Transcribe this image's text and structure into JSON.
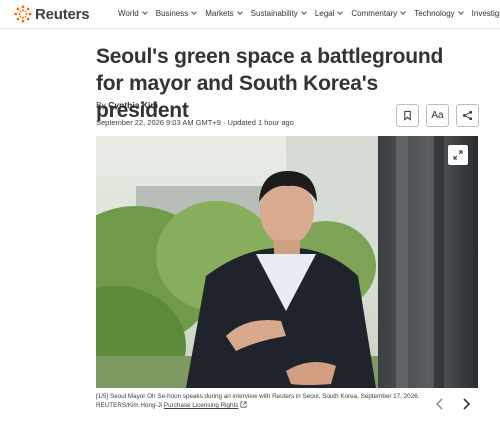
{
  "brand": {
    "name": "Reuters",
    "accent": "#fa6400"
  },
  "nav": {
    "items": [
      {
        "label": "World",
        "dropdown": true
      },
      {
        "label": "Business",
        "dropdown": true
      },
      {
        "label": "Markets",
        "dropdown": true
      },
      {
        "label": "Sustainability",
        "dropdown": true
      },
      {
        "label": "Legal",
        "dropdown": true
      },
      {
        "label": "Commentary",
        "dropdown": true
      },
      {
        "label": "Technology",
        "dropdown": true
      },
      {
        "label": "Investigations",
        "dropdown": false
      }
    ]
  },
  "article": {
    "headline": "Seoul's green space a battleground for mayor and South Korea's president",
    "byline_prefix": "By",
    "author": "Cynthia Kim",
    "date": "September 22, 2026 9:03 AM GMT+9 · Updated 1 hour ago",
    "tools": [
      {
        "name": "bookmark",
        "icon": "bookmark-icon"
      },
      {
        "name": "text-size",
        "label": "Aa"
      },
      {
        "name": "share",
        "icon": "share-icon"
      }
    ]
  },
  "photo": {
    "icon": "expand-icon",
    "caption_index": "[1/5]",
    "caption_text": "Seoul Mayor Oh Se-hoon speaks during an interview with Reuters in Seoul, South Korea, September 17, 2026.",
    "credit": "REUTERS/Kim Hong-Ji",
    "licensing_link": "Purchase Licensing Rights"
  },
  "carousel": {
    "prev_icon": "chevron-left-icon",
    "next_icon": "chevron-right-icon"
  }
}
